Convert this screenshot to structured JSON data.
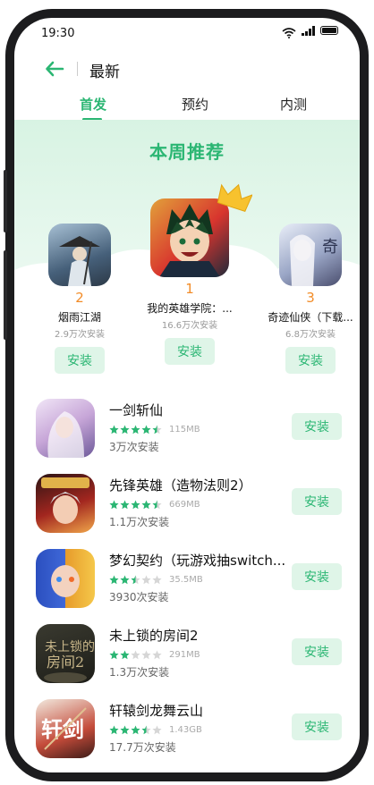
{
  "status": {
    "time": "19:30"
  },
  "header": {
    "title": "最新"
  },
  "tabs": [
    {
      "label": "首发"
    },
    {
      "label": "预约"
    },
    {
      "label": "内测"
    }
  ],
  "featured": {
    "title": "本周推荐",
    "items": [
      {
        "rank": "2",
        "name": "烟雨江湖",
        "downloads": "2.9万次安装",
        "install": "安装"
      },
      {
        "rank": "1",
        "name": "我的英雄学院：...",
        "downloads": "16.6万次安装",
        "install": "安装"
      },
      {
        "rank": "3",
        "name": "奇迹仙侠（下载...",
        "downloads": "6.8万次安装",
        "install": "安装"
      }
    ]
  },
  "list": [
    {
      "name": "一剑斩仙",
      "rating": 4.5,
      "size": "115MB",
      "downloads": "3万次安装",
      "install": "安装"
    },
    {
      "name": "先锋英雄（造物法则2）",
      "rating": 4.5,
      "size": "669MB",
      "downloads": "1.1万次安装",
      "install": "安装"
    },
    {
      "name": "梦幻契约（玩游戏抽switch...",
      "rating": 2.5,
      "size": "35.5MB",
      "downloads": "3930次安装",
      "install": "安装"
    },
    {
      "name": "未上锁的房间2",
      "rating": 2,
      "size": "291MB",
      "downloads": "1.3万次安装",
      "install": "安装"
    },
    {
      "name": "轩辕剑龙舞云山",
      "rating": 3.5,
      "size": "1.43GB",
      "downloads": "17.7万次安装",
      "install": "安装"
    }
  ],
  "colors": {
    "accent": "#2bb673",
    "rank": "#f28c28",
    "install_bg": "#dff5e8"
  },
  "icons": {
    "back": "back-arrow-icon",
    "wifi": "wifi-icon",
    "signal": "signal-icon",
    "battery": "battery-icon",
    "crown": "crown-icon",
    "star": "star-icon"
  }
}
